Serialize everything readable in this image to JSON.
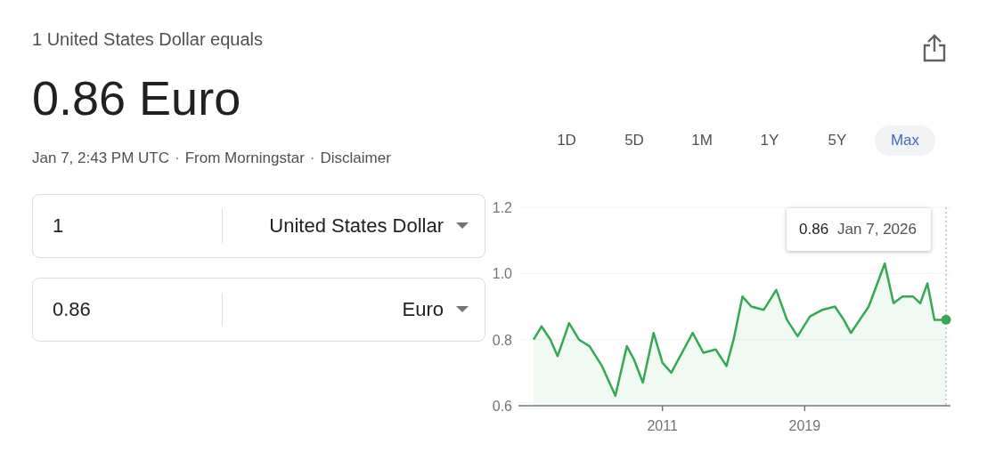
{
  "summary": {
    "caption": "1 United States Dollar equals",
    "result": "0.86 Euro",
    "meta": [
      "Jan 7, 2:43 PM UTC",
      "From Morningstar",
      "Disclaimer"
    ],
    "separator": "·"
  },
  "converter": [
    {
      "amount": "1",
      "currency": "United States Dollar"
    },
    {
      "amount": "0.86",
      "currency": "Euro"
    }
  ],
  "ranges": [
    {
      "label": "1D",
      "selected": false
    },
    {
      "label": "5D",
      "selected": false
    },
    {
      "label": "1M",
      "selected": false
    },
    {
      "label": "1Y",
      "selected": false
    },
    {
      "label": "5Y",
      "selected": false
    },
    {
      "label": "Max",
      "selected": true
    }
  ],
  "chart": {
    "tooltip": {
      "value": "0.86",
      "date": "Jan 7, 2026"
    },
    "chart_data": {
      "type": "area",
      "xlim": [
        2002.9,
        2027.2
      ],
      "ylim": [
        0.6,
        1.2
      ],
      "yticks": [
        0.6,
        0.8,
        {
          "value": 1.0,
          "label": "1.0"
        },
        1.2
      ],
      "xticks": [
        2011,
        2019
      ],
      "ref_lines": [
        {
          "axis": "x",
          "value": 2026.95
        }
      ],
      "x": [
        2003.75,
        2004.2,
        2004.7,
        2005.1,
        2005.75,
        2006.3,
        2006.9,
        2007.6,
        2008.35,
        2009.0,
        2009.4,
        2009.9,
        2010.5,
        2011.0,
        2011.5,
        2012.1,
        2012.7,
        2013.3,
        2014.0,
        2014.6,
        2015.0,
        2015.5,
        2016.0,
        2016.7,
        2017.4,
        2018.0,
        2018.6,
        2019.3,
        2020.0,
        2020.7,
        2021.2,
        2021.6,
        2022.1,
        2022.6,
        2023.5,
        2024.0,
        2024.5,
        2025.1,
        2025.5,
        2025.9,
        2026.3,
        2026.95
      ],
      "series": [
        {
          "color": "#34a853",
          "values": [
            0.8,
            0.84,
            0.8,
            0.75,
            0.85,
            0.8,
            0.78,
            0.72,
            0.63,
            0.78,
            0.74,
            0.67,
            0.82,
            0.73,
            0.7,
            0.76,
            0.82,
            0.76,
            0.77,
            0.72,
            0.8,
            0.93,
            0.9,
            0.89,
            0.95,
            0.86,
            0.81,
            0.87,
            0.89,
            0.9,
            0.86,
            0.82,
            0.86,
            0.9,
            1.03,
            0.91,
            0.93,
            0.93,
            0.91,
            0.97,
            0.86,
            0.86
          ]
        }
      ]
    }
  }
}
